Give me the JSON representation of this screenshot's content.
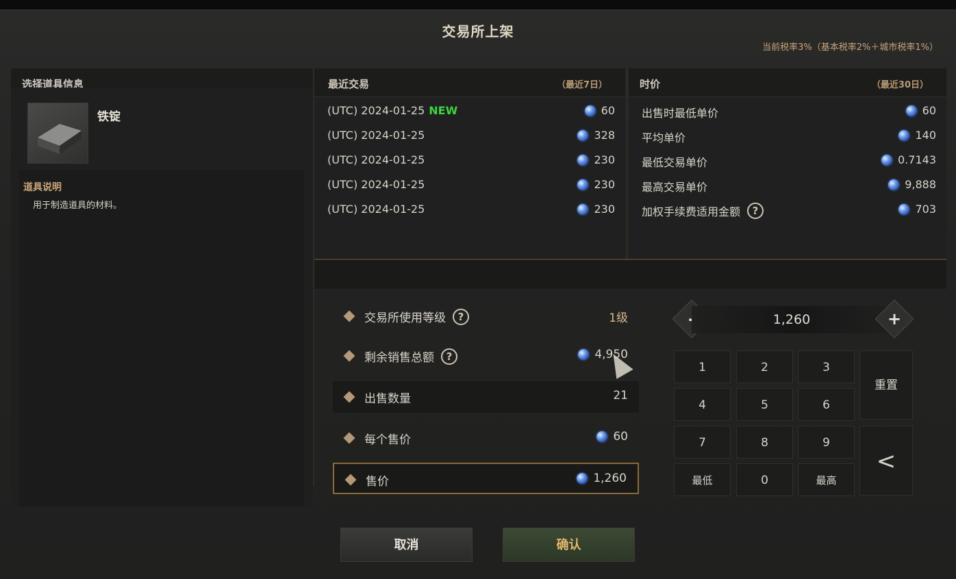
{
  "window": {
    "title": "交易所上架",
    "tax_info": "当前税率3%（基本税率2%＋城市税率1%）"
  },
  "item_panel": {
    "header": "选择道具信息",
    "item_name": "铁锭",
    "item_icon": "iron-ingot-icon",
    "desc_title": "道具说明",
    "desc_text": "用于制造道具的材料。"
  },
  "recent": {
    "header": "最近交易",
    "period": "（最近7日）",
    "rows": [
      {
        "date": "(UTC) 2024-01-25",
        "badge": "NEW",
        "price": "60"
      },
      {
        "date": "(UTC) 2024-01-25",
        "badge": "",
        "price": "328"
      },
      {
        "date": "(UTC) 2024-01-25",
        "badge": "",
        "price": "230"
      },
      {
        "date": "(UTC) 2024-01-25",
        "badge": "",
        "price": "230"
      },
      {
        "date": "(UTC) 2024-01-25",
        "badge": "",
        "price": "230"
      }
    ]
  },
  "market": {
    "header": "时价",
    "period": "（最近30日）",
    "rows": [
      {
        "label": "出售时最低单价",
        "value": "60"
      },
      {
        "label": "平均单价",
        "value": "140"
      },
      {
        "label": "最低交易单价",
        "value": "0.7143"
      },
      {
        "label": "最高交易单价",
        "value": "9,888"
      },
      {
        "label": "加权手续费适用金额",
        "value": "703"
      }
    ]
  },
  "form": {
    "level_label": "交易所使用等级",
    "level_value": "1级",
    "remaining_label": "剩余销售总额",
    "remaining_value": "4,950",
    "qty_label": "出售数量",
    "qty_value": "21",
    "unit_label": "每个售价",
    "unit_value": "60",
    "total_label": "售价",
    "total_value": "1,260"
  },
  "keypad": {
    "display": "1,260",
    "minus": "-",
    "plus": "+",
    "keys": [
      "1",
      "2",
      "3",
      "4",
      "5",
      "6",
      "7",
      "8",
      "9",
      "最低",
      "0",
      "最高"
    ],
    "reset": "重置",
    "back": "<"
  },
  "buttons": {
    "cancel": "取消",
    "confirm": "确认"
  },
  "colors": {
    "accent_gold": "#c9a57a",
    "new_green": "#3fd23f",
    "confirm_text": "#e4b86a"
  }
}
